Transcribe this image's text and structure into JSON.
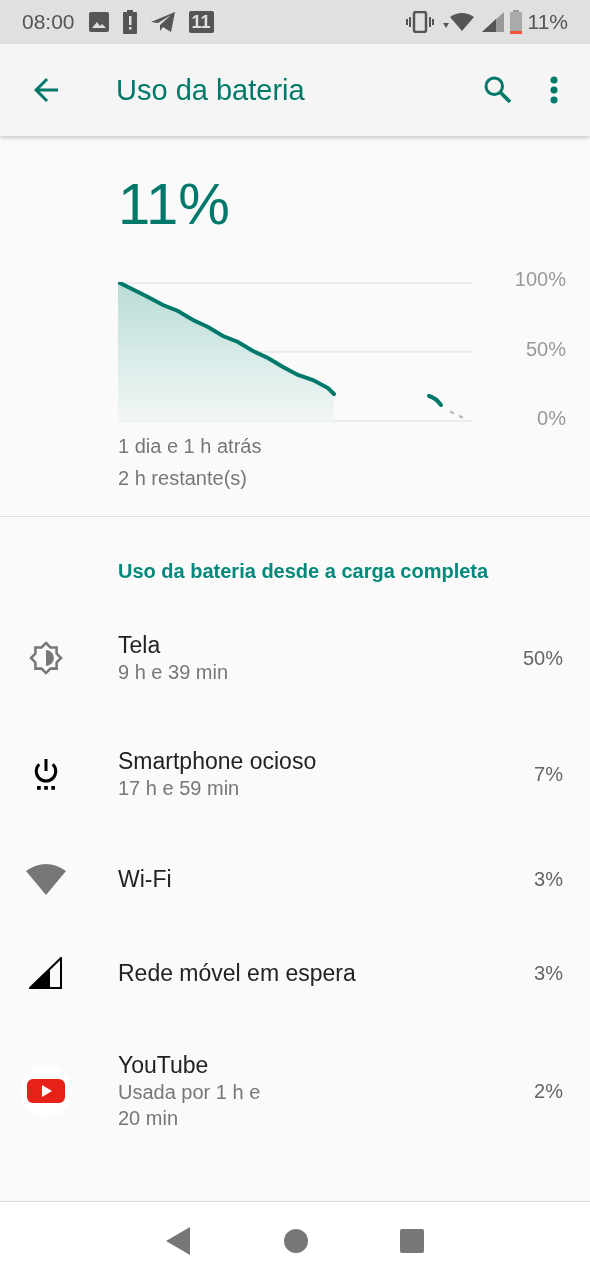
{
  "status_bar": {
    "time": "08:00",
    "calendar_day": "11",
    "battery_text": "11%"
  },
  "app_bar": {
    "title": "Uso da bateria"
  },
  "summary": {
    "percent": "11%",
    "y_labels": [
      "100%",
      "50%",
      "0%"
    ],
    "since": "1 dia e 1 h atrás",
    "remaining": "2 h restante(s)"
  },
  "section": {
    "title": "Uso da bateria desde a carga completa"
  },
  "items": [
    {
      "kind": "screen",
      "title": "Tela",
      "subtitle": "9 h e 39 min",
      "percent": "50%"
    },
    {
      "kind": "idle",
      "title": "Smartphone ocioso",
      "subtitle": "17 h e 59 min",
      "percent": "7%"
    },
    {
      "kind": "wifi",
      "title": "Wi-Fi",
      "percent": "3%"
    },
    {
      "kind": "cell",
      "title": "Rede móvel em espera",
      "percent": "3%"
    },
    {
      "kind": "app",
      "title": "YouTube",
      "subtitle": "Usada por 1 h e\n20 min",
      "percent": "2%"
    }
  ]
}
